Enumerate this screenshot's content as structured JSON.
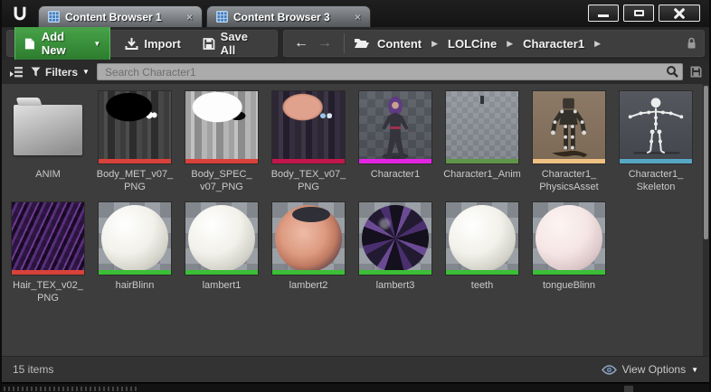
{
  "window_controls": {
    "minimize": "minimize",
    "maximize": "maximize",
    "close": "close"
  },
  "tabs": [
    {
      "label": "Content Browser 1",
      "active": true
    },
    {
      "label": "Content Browser 3",
      "active": false
    }
  ],
  "icons": {
    "tab_close": "×",
    "caret_down": "▼",
    "back_arrow": "←",
    "forward_arrow": "→",
    "breadcrumb_arrow": "▶"
  },
  "toolbar": {
    "add_new_label": "Add New",
    "import_label": "Import",
    "save_all_label": "Save All"
  },
  "breadcrumb": {
    "items": [
      "Content",
      "LOLCine",
      "Character1"
    ],
    "separator": "▶"
  },
  "filter_bar": {
    "filters_label": "Filters",
    "search_placeholder": "Search Character1",
    "search_value": ""
  },
  "grid": {
    "items": [
      {
        "label": "ANIM",
        "kind": "folder",
        "thumb": "folder",
        "bar": null
      },
      {
        "label": "Body_MET_v07_PNG",
        "kind": "texture",
        "thumb": "tex-met",
        "bar": "#d8423a"
      },
      {
        "label": "Body_SPEC_v07_PNG",
        "kind": "texture",
        "thumb": "tex-spec",
        "bar": "#d8423a"
      },
      {
        "label": "Body_TEX_v07_PNG",
        "kind": "texture",
        "thumb": "tex-body",
        "bar": "#c2164c"
      },
      {
        "label": "Character1",
        "kind": "skeletal-mesh",
        "thumb": "char-preview",
        "bar": "#e325e3"
      },
      {
        "label": "Character1_Anim",
        "kind": "animation",
        "thumb": "anim-preview",
        "bar": "#5e9548"
      },
      {
        "label": "Character1_PhysicsAsset",
        "kind": "physics-asset",
        "thumb": "physics-preview",
        "bar": "#efc183"
      },
      {
        "label": "Character1_Skeleton",
        "kind": "skeleton",
        "thumb": "skeleton-preview",
        "bar": "#56a7c4"
      },
      {
        "label": "Hair_TEX_v02_PNG",
        "kind": "texture",
        "thumb": "tex-hair",
        "bar": "#d8423a"
      },
      {
        "label": "hairBlinn",
        "kind": "material",
        "thumb": "sphere-white",
        "bar": "#3bbf37"
      },
      {
        "label": "lambert1",
        "kind": "material",
        "thumb": "sphere-white",
        "bar": "#3bbf37"
      },
      {
        "label": "lambert2",
        "kind": "material",
        "thumb": "sphere-skin",
        "bar": "#3bbf37"
      },
      {
        "label": "lambert3",
        "kind": "material",
        "thumb": "sphere-purple",
        "bar": "#3bbf37"
      },
      {
        "label": "teeth",
        "kind": "material",
        "thumb": "sphere-white",
        "bar": "#3bbf37"
      },
      {
        "label": "tongueBlinn",
        "kind": "material",
        "thumb": "sphere-pink",
        "bar": "#3bbf37"
      }
    ]
  },
  "status_bar": {
    "items_count": "15 items",
    "view_options_label": "View Options"
  },
  "colors": {
    "accent_green": "#3f9b41",
    "texture_bar": "#d8423a",
    "material_bar": "#3bbf37",
    "skeletal_mesh_bar": "#e325e3",
    "animation_bar": "#5e9548",
    "physics_bar": "#efc183",
    "skeleton_bar": "#56a7c4"
  }
}
